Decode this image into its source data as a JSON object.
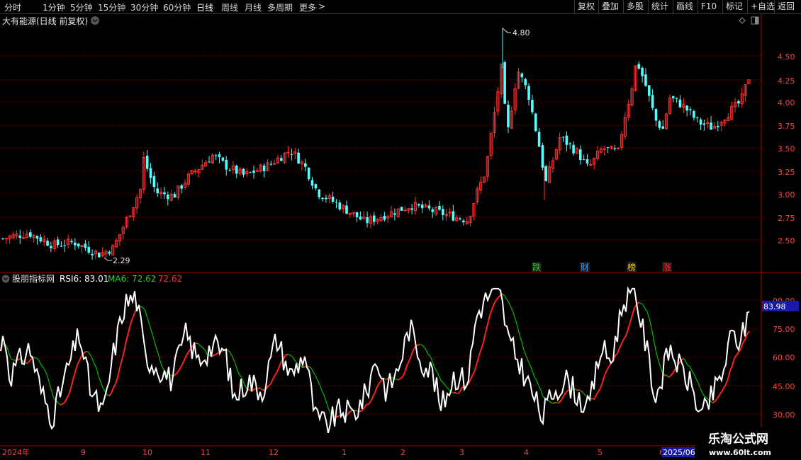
{
  "toolbar": {
    "periods": [
      "分时",
      "1分钟",
      "5分钟",
      "15分钟",
      "30分钟",
      "60分钟",
      "日线",
      "周线",
      "月线",
      "多周期",
      "更多"
    ],
    "active_period": "日线",
    "more_arrow": ">",
    "actions": [
      "复权",
      "叠加",
      "多股",
      "统计",
      "画线",
      "F10",
      "标记",
      "+自选",
      "返回"
    ]
  },
  "main_panel": {
    "title": "大有能源(日线 前复权)",
    "collapse_icon": "chevron-down-icon",
    "diamond_icon": "diamond-icon",
    "layout_icon": "panel-layout-icon",
    "high_label": "4.80",
    "low_label": "2.29",
    "price_axis": [
      "4.50",
      "4.25",
      "4.00",
      "3.75",
      "3.50",
      "3.25",
      "3.00",
      "2.75",
      "2.50"
    ],
    "event_markers": [
      {
        "text": "跌",
        "color": "#33cc33"
      },
      {
        "text": "财",
        "color": "#3399ff"
      },
      {
        "text": "榜",
        "color": "#ffcc00"
      },
      {
        "text": "涨",
        "color": "#ff3333"
      }
    ]
  },
  "indicator_panel": {
    "name": "股朋指标网",
    "rsi_label": "RSI6: 83.01",
    "ma_label": "MA6: 72.62",
    "ma_value2": ": 72.62",
    "axis": [
      "90.00",
      "75.00",
      "60.00",
      "45.00",
      "30.00"
    ],
    "current_value": "83.98"
  },
  "time_axis": [
    "2024年",
    "9",
    "10",
    "11",
    "12",
    "1",
    "2",
    "3",
    "4",
    "5",
    "6",
    "2025/06"
  ],
  "watermark": {
    "title": "乐淘公式网",
    "url": "www.60lt.com"
  },
  "colors": {
    "up": "#ff3232",
    "down": "#54ffff",
    "rsi": "#ffffff",
    "ma_up": "#ff2020",
    "ma_down": "#00c000",
    "grid": "#8c0000",
    "axis_text": "#ff4040",
    "highlight": "#1a1aa8"
  }
}
